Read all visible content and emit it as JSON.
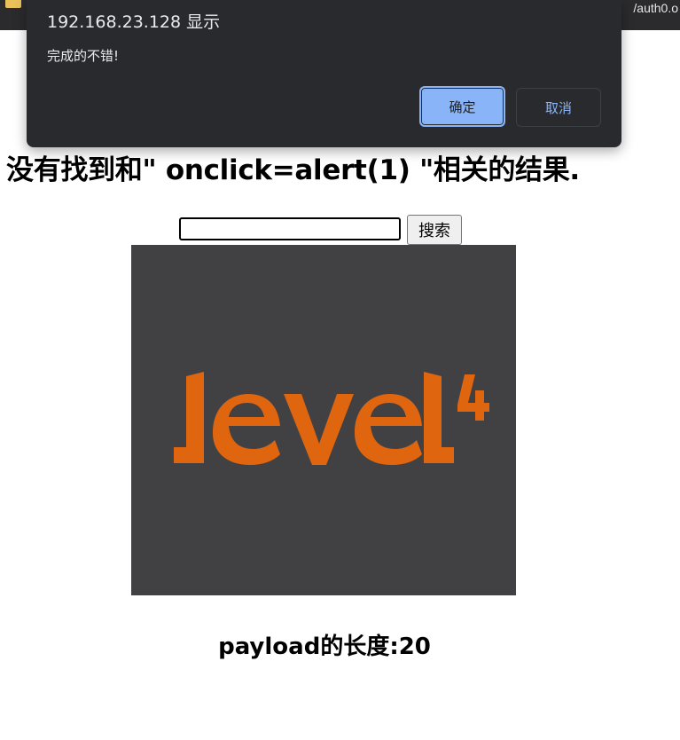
{
  "browser": {
    "url_fragment": "/auth0.o"
  },
  "dialog": {
    "title": "192.168.23.128 显示",
    "message": "完成的不错!",
    "ok_label": "确定",
    "cancel_label": "取消",
    "ok_color": "#8ab4f8",
    "background_color": "#292a2d"
  },
  "page": {
    "heading": "没有找到和\" onclick=alert(1) \"相关的结果.",
    "search": {
      "value": "",
      "button_label": "搜索"
    },
    "logo": {
      "text": "level4",
      "icon": "level4-logo",
      "background_color": "#414144",
      "text_color": "#e0650f"
    },
    "payload_text": "payload的长度:20"
  }
}
